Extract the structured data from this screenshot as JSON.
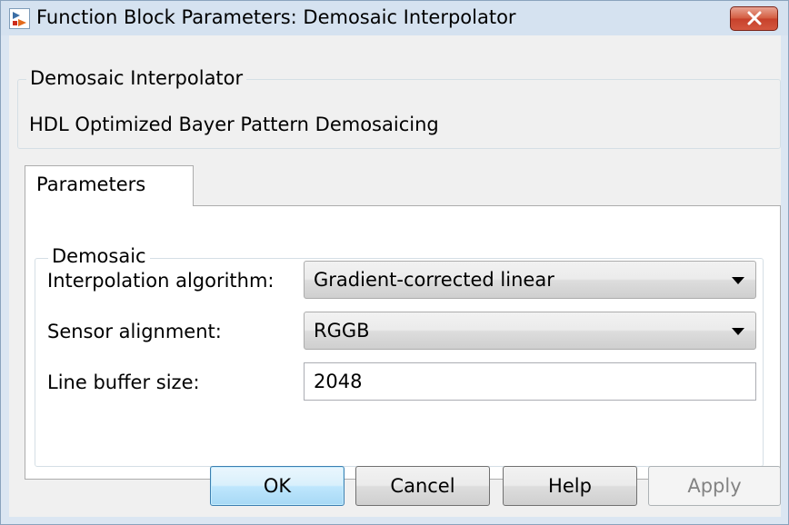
{
  "window": {
    "title": "Function Block Parameters: Demosaic Interpolator",
    "icon": "simulink-block-icon",
    "close_icon": "close-x-icon"
  },
  "description_group": {
    "legend": "Demosaic Interpolator",
    "text": "HDL Optimized Bayer Pattern Demosaicing"
  },
  "tabs": [
    {
      "label": "Parameters",
      "selected": true
    }
  ],
  "demosaic_group": {
    "legend": "Demosaic",
    "fields": {
      "interpolation_algorithm": {
        "label": "Interpolation algorithm:",
        "value": "Gradient-corrected linear"
      },
      "sensor_alignment": {
        "label": "Sensor alignment:",
        "value": "RGGB"
      },
      "line_buffer_size": {
        "label": "Line buffer size:",
        "value": "2048"
      }
    }
  },
  "buttons": {
    "ok": "OK",
    "cancel": "Cancel",
    "help": "Help",
    "apply": "Apply"
  },
  "colors": {
    "close_button": "#c7412b",
    "default_button": "#bee6fd",
    "titlebar": "#d5e2f0"
  }
}
